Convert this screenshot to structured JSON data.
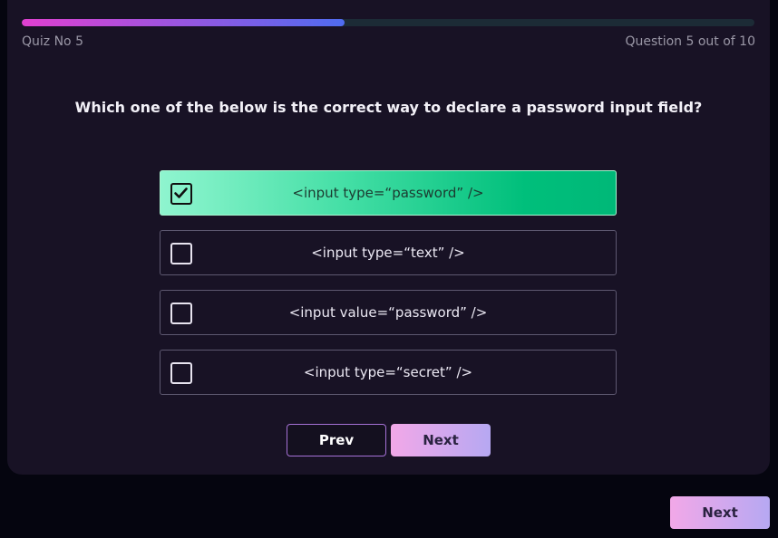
{
  "progress": {
    "current": 5,
    "total": 10,
    "fraction": 0.44
  },
  "header": {
    "quiz_label": "Quiz No 5",
    "question_counter": "Question 5 out of 10"
  },
  "question": "Which one of the below is the correct way to declare a password input field?",
  "options": [
    {
      "label": "<input type=“password” />",
      "checked": true
    },
    {
      "label": "<input type=“text” />",
      "checked": false
    },
    {
      "label": "<input value=“password” />",
      "checked": false
    },
    {
      "label": "<input type=“secret” />",
      "checked": false
    }
  ],
  "nav": {
    "prev_label": "Prev",
    "next_label": "Next"
  },
  "footer": {
    "next_label": "Next"
  },
  "colors": {
    "background": "#05050f",
    "card": "#181225",
    "selected_option_start": "#8ff5cf",
    "selected_option_end": "#00b878",
    "progress_start": "#e040d0",
    "progress_end": "#4f6cf0",
    "button_gradient_start": "#f2a8e8",
    "button_gradient_end": "#b6a8f2"
  },
  "icons": {
    "checked": "checkmark-icon"
  }
}
